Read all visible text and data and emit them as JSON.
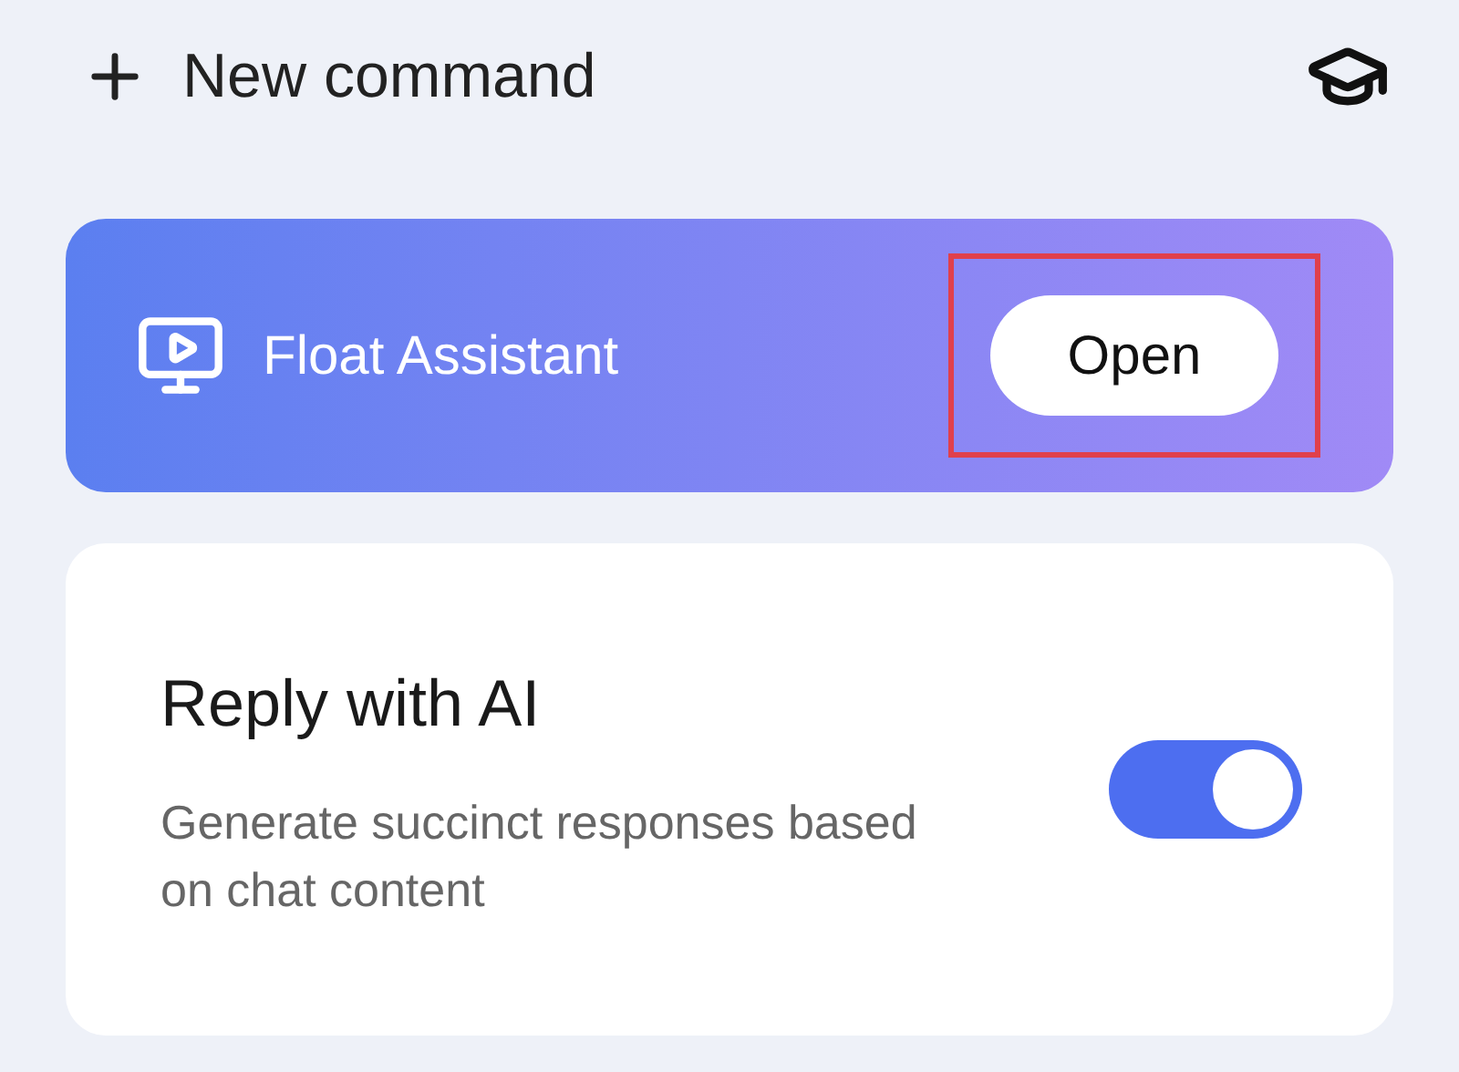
{
  "header": {
    "new_command": "New command"
  },
  "float_card": {
    "title": "Float Assistant",
    "button": {
      "label": "Open",
      "highlighted": true
    }
  },
  "ai_card": {
    "title": "Reply with AI",
    "description": "Generate succinct responses based on chat content",
    "toggle": {
      "on": true
    }
  }
}
